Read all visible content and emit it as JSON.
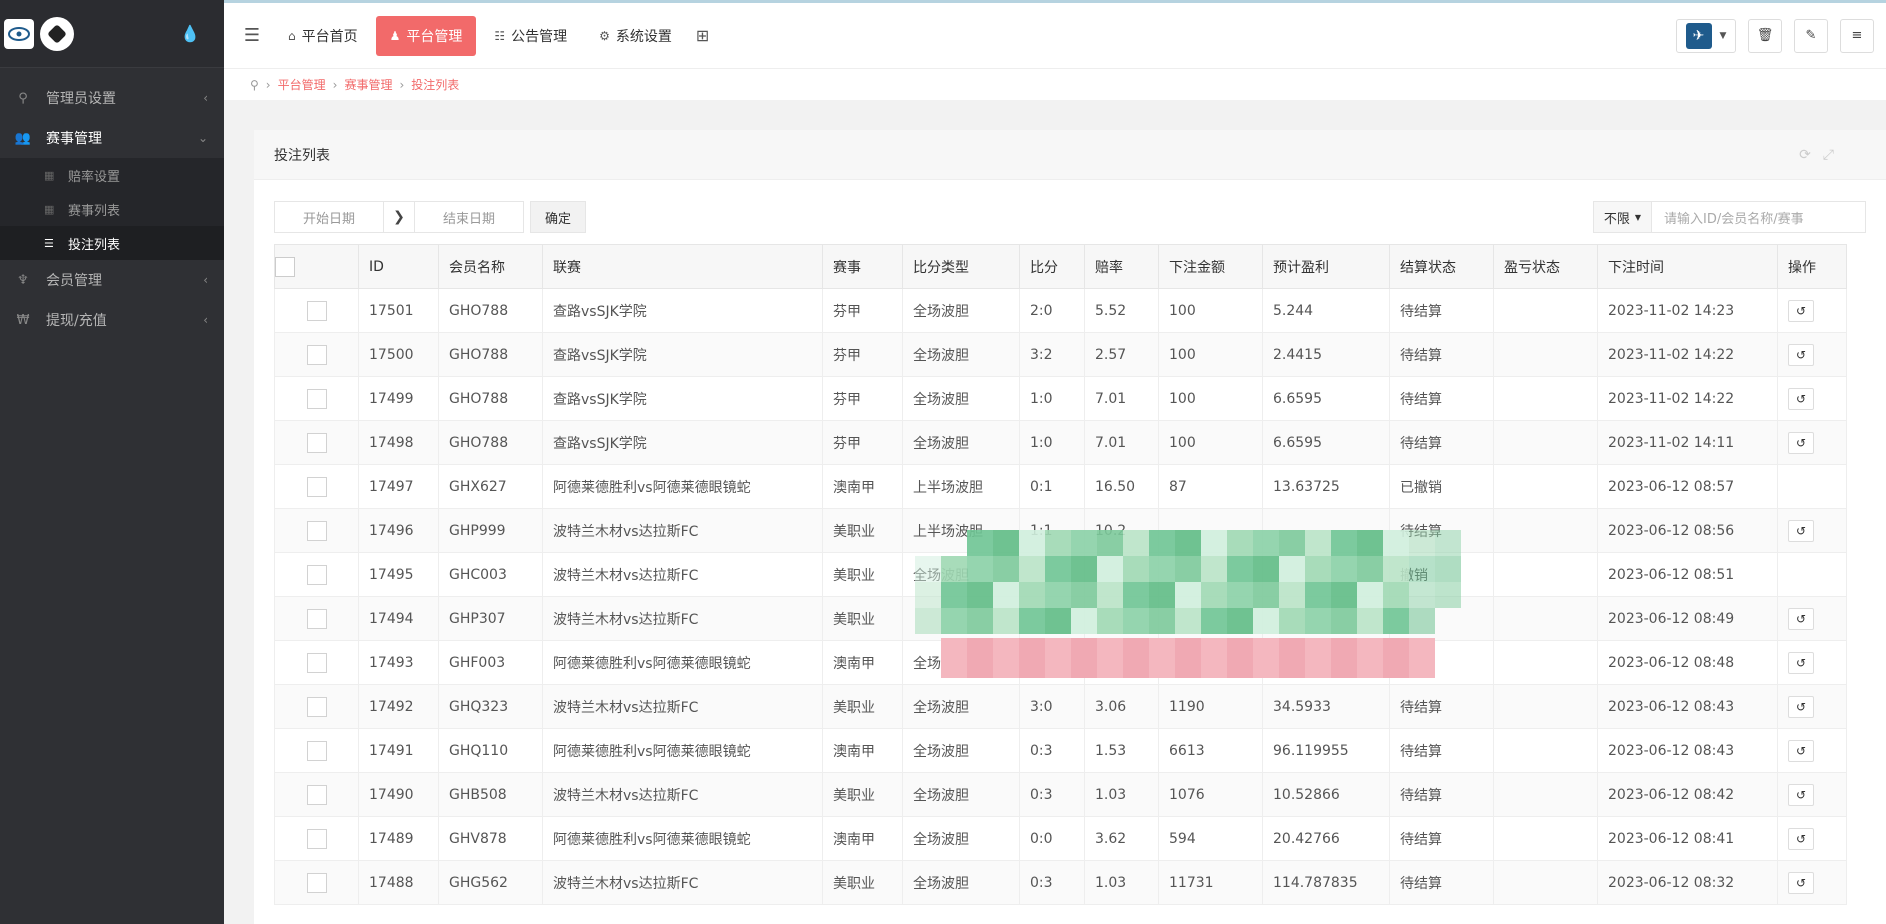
{
  "sidebar": {
    "menu": [
      {
        "label": "管理员设置",
        "icon": "key-icon",
        "glyph": "⚲",
        "open": false,
        "arrow": "‹"
      },
      {
        "label": "赛事管理",
        "icon": "users-icon",
        "glyph": "👥",
        "open": true,
        "arrow": "⌄",
        "children": [
          {
            "label": "赔率设置",
            "icon": "table-icon",
            "glyph": "▦",
            "active": false
          },
          {
            "label": "赛事列表",
            "icon": "table-icon",
            "glyph": "▦",
            "active": false
          },
          {
            "label": "投注列表",
            "icon": "list-icon",
            "glyph": "☰",
            "active": true
          }
        ]
      },
      {
        "label": "会员管理",
        "icon": "person-icon",
        "glyph": "♆",
        "open": false,
        "arrow": "‹"
      },
      {
        "label": "提现/充值",
        "icon": "yen-icon",
        "glyph": "₩",
        "open": false,
        "arrow": "‹"
      }
    ]
  },
  "topbar": {
    "tabs": [
      {
        "label": "平台首页",
        "icon": "home-icon",
        "glyph": "⌂",
        "active": false
      },
      {
        "label": "平台管理",
        "icon": "user-icon",
        "glyph": "♟",
        "active": true
      },
      {
        "label": "公告管理",
        "icon": "list-alt-icon",
        "glyph": "☷",
        "active": false
      },
      {
        "label": "系统设置",
        "icon": "gear-icon",
        "glyph": "⚙",
        "active": false
      }
    ]
  },
  "breadcrumb": [
    "平台管理",
    "赛事管理",
    "投注列表"
  ],
  "panel": {
    "title": "投注列表"
  },
  "filter": {
    "start_placeholder": "开始日期",
    "end_placeholder": "结束日期",
    "confirm_label": "确定",
    "select_value": "不限",
    "search_placeholder": "请输入ID/会员名称/赛事"
  },
  "table": {
    "columns": [
      "ID",
      "会员名称",
      "联赛",
      "赛事",
      "比分类型",
      "比分",
      "赔率",
      "下注金额",
      "预计盈利",
      "结算状态",
      "盈亏状态",
      "下注时间",
      "操作"
    ],
    "rows": [
      [
        "17501",
        "GHO788",
        "查路vsSJK学院",
        "芬甲",
        "全场波胆",
        "2:0",
        "5.52",
        "100",
        "5.244",
        "待结算",
        "",
        "2023-11-02 14:23",
        true
      ],
      [
        "17500",
        "GHO788",
        "查路vsSJK学院",
        "芬甲",
        "全场波胆",
        "3:2",
        "2.57",
        "100",
        "2.4415",
        "待结算",
        "",
        "2023-11-02 14:22",
        true
      ],
      [
        "17499",
        "GHO788",
        "查路vsSJK学院",
        "芬甲",
        "全场波胆",
        "1:0",
        "7.01",
        "100",
        "6.6595",
        "待结算",
        "",
        "2023-11-02 14:22",
        true
      ],
      [
        "17498",
        "GHO788",
        "查路vsSJK学院",
        "芬甲",
        "全场波胆",
        "1:0",
        "7.01",
        "100",
        "6.6595",
        "待结算",
        "",
        "2023-11-02 14:11",
        true
      ],
      [
        "17497",
        "GHX627",
        "阿德莱德胜利vs阿德莱德眼镜蛇",
        "澳南甲",
        "上半场波胆",
        "0:1",
        "16.50",
        "87",
        "13.63725",
        "已撤销",
        "",
        "2023-06-12 08:57",
        false
      ],
      [
        "17496",
        "GHP999",
        "波特兰木材vs达拉斯FC",
        "美职业",
        "上半场波胆",
        "1:1",
        "10.2",
        "",
        "",
        "待结算",
        "",
        "2023-06-12 08:56",
        true
      ],
      [
        "17495",
        "GHC003",
        "波特兰木材vs达拉斯FC",
        "美职业",
        "全场波胆",
        "",
        "",
        "",
        "",
        "撤销",
        "",
        "2023-06-12 08:51",
        false
      ],
      [
        "17494",
        "GHP307",
        "波特兰木材vs达拉斯FC",
        "美职业",
        "",
        "",
        "",
        "",
        "",
        "",
        "",
        "2023-06-12 08:49",
        true
      ],
      [
        "17493",
        "GHF003",
        "阿德莱德胜利vs阿德莱德眼镜蛇",
        "澳南甲",
        "全场波",
        "",
        "",
        "",
        "",
        "结算",
        "",
        "2023-06-12 08:48",
        true
      ],
      [
        "17492",
        "GHQ323",
        "波特兰木材vs达拉斯FC",
        "美职业",
        "全场波胆",
        "3:0",
        "3.06",
        "1190",
        "34.5933",
        "待结算",
        "",
        "2023-06-12 08:43",
        true
      ],
      [
        "17491",
        "GHQ110",
        "阿德莱德胜利vs阿德莱德眼镜蛇",
        "澳南甲",
        "全场波胆",
        "0:3",
        "1.53",
        "6613",
        "96.119955",
        "待结算",
        "",
        "2023-06-12 08:43",
        true
      ],
      [
        "17490",
        "GHB508",
        "波特兰木材vs达拉斯FC",
        "美职业",
        "全场波胆",
        "0:3",
        "1.03",
        "1076",
        "10.52866",
        "待结算",
        "",
        "2023-06-12 08:42",
        true
      ],
      [
        "17489",
        "GHV878",
        "阿德莱德胜利vs阿德莱德眼镜蛇",
        "澳南甲",
        "全场波胆",
        "0:0",
        "3.62",
        "594",
        "20.42766",
        "待结算",
        "",
        "2023-06-12 08:41",
        true
      ],
      [
        "17488",
        "GHG562",
        "波特兰木材vs达拉斯FC",
        "美职业",
        "全场波胆",
        "0:3",
        "1.03",
        "11731",
        "114.787835",
        "待结算",
        "",
        "2023-06-12 08:32",
        true
      ]
    ]
  }
}
